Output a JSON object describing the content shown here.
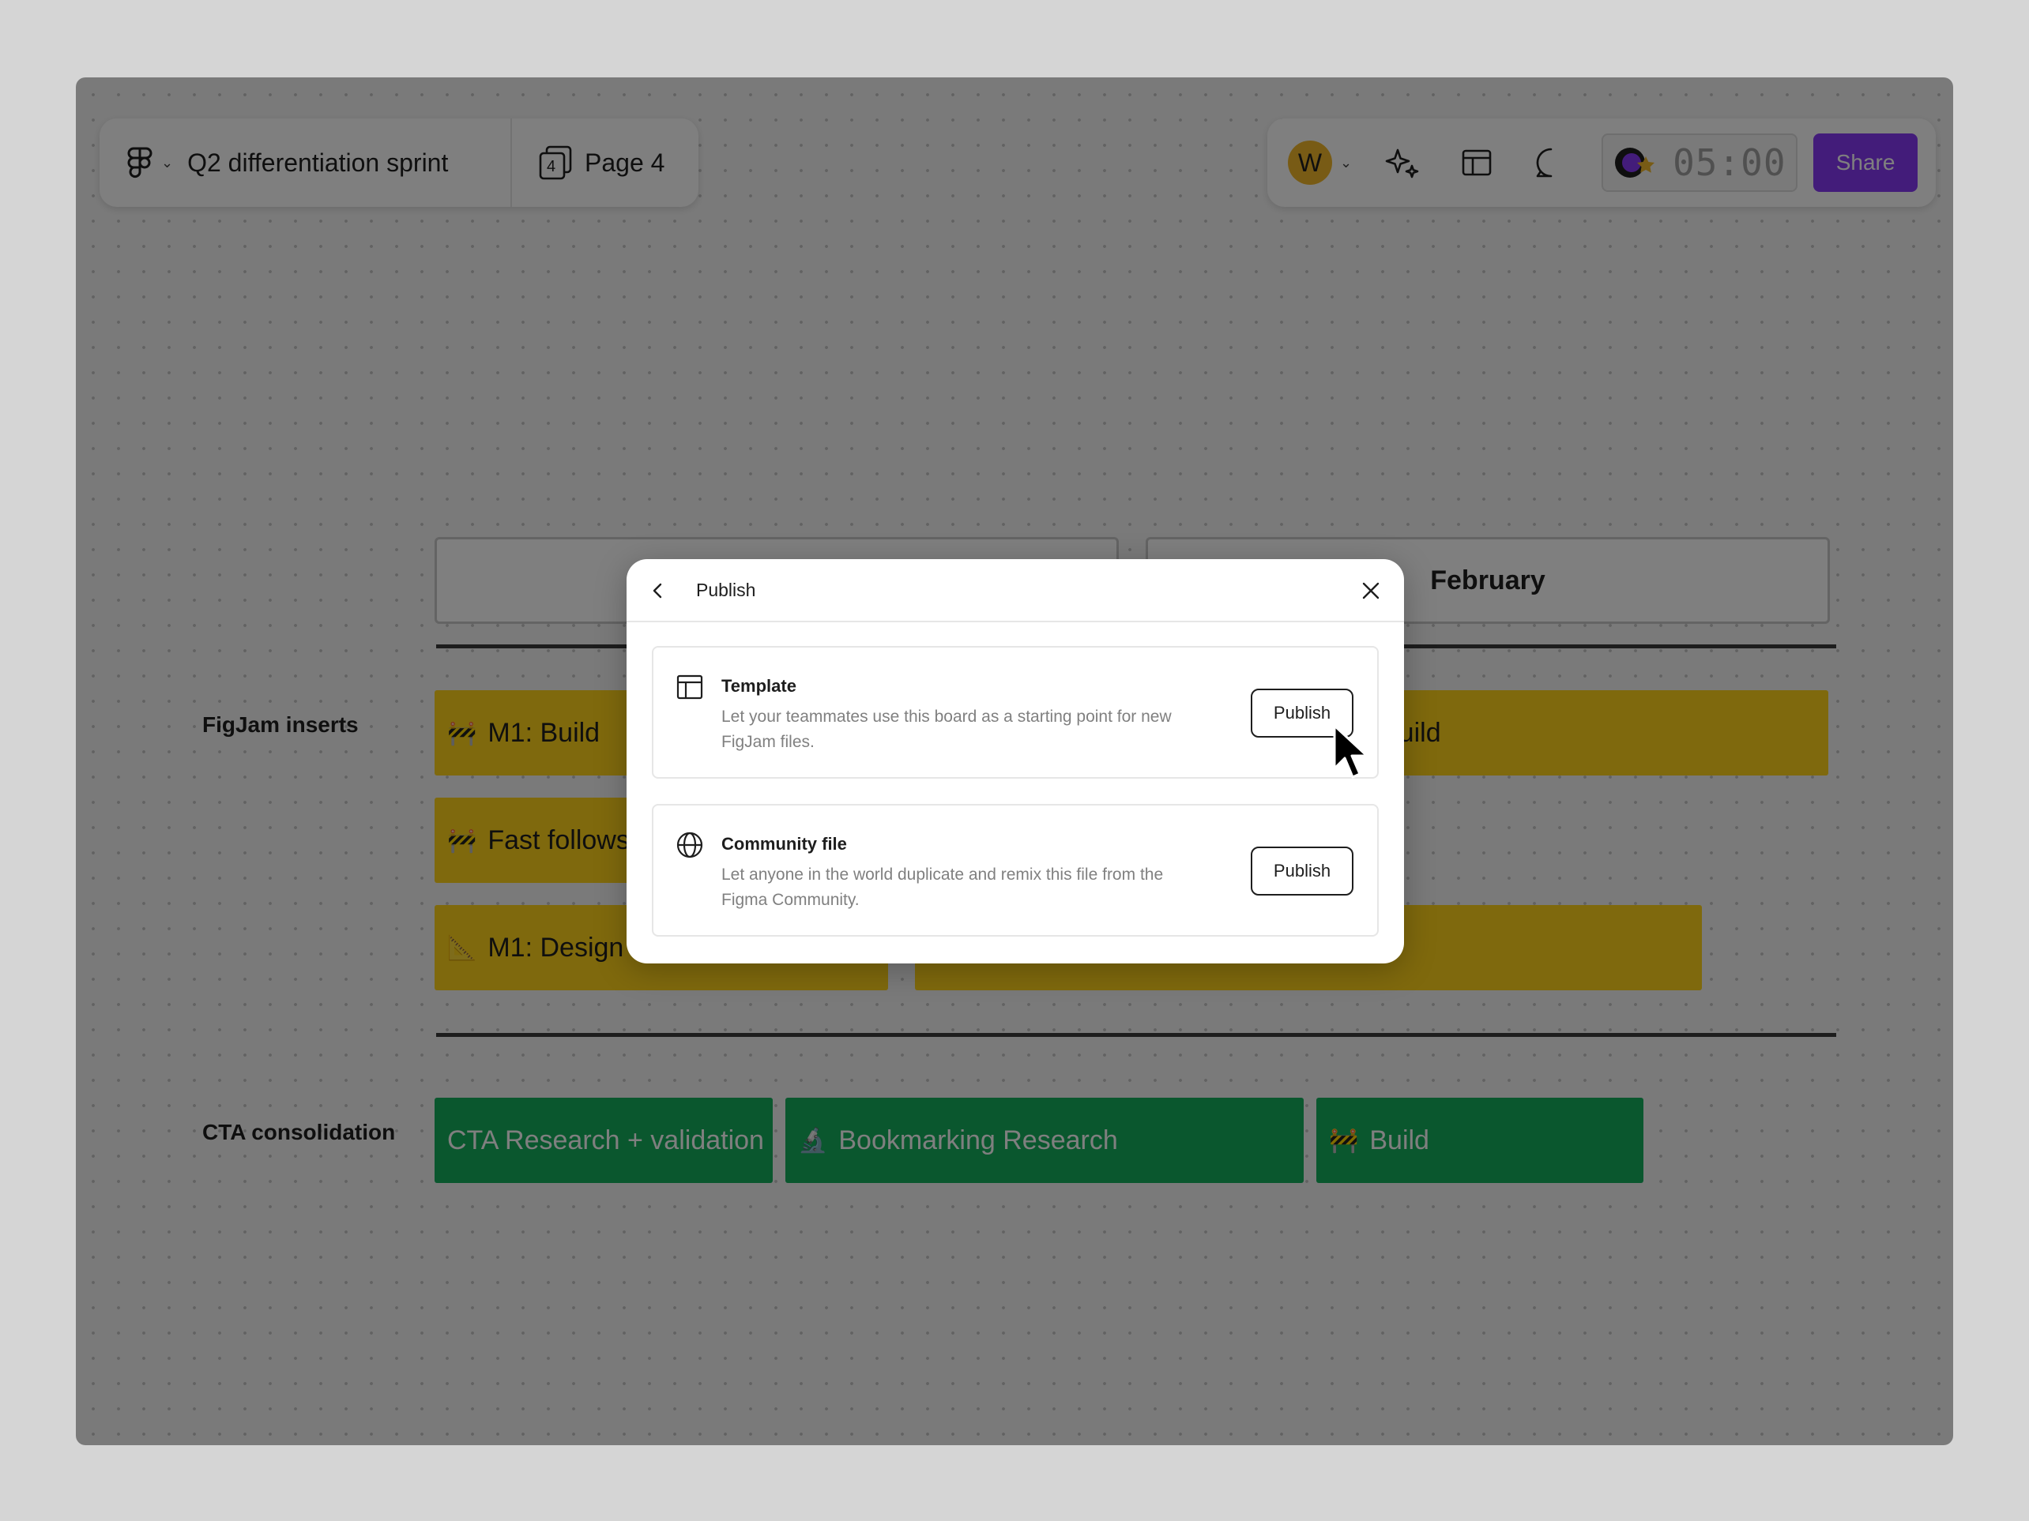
{
  "toolbar": {
    "file_title": "Q2 differentiation sprint",
    "page_count": "4",
    "page_name": "Page 4",
    "avatar_initial": "W",
    "timer": "05:00",
    "share_label": "Share"
  },
  "board": {
    "months": [
      "",
      "February"
    ],
    "rows": [
      {
        "label": "FigJam inserts"
      },
      {
        "label": "CTA consolidation"
      }
    ],
    "bars": {
      "m1_build": {
        "emoji": "🚧",
        "label": "M1: Build"
      },
      "right_build": {
        "label": "Build"
      },
      "fast_follows": {
        "emoji": "🚧",
        "label": "Fast follows"
      },
      "m1_design": {
        "emoji": "📐",
        "label": "M1: Design"
      },
      "cta_research": {
        "label": "CTA Research + validation"
      },
      "bookmarking": {
        "emoji": "🔬",
        "label": "Bookmarking Research"
      },
      "cta_build": {
        "emoji": "🚧",
        "label": "Build"
      }
    },
    "colors": {
      "yellow": "#ffd21a",
      "green": "#14ae5c"
    }
  },
  "dialog": {
    "title": "Publish",
    "options": [
      {
        "icon": "template-icon",
        "title": "Template",
        "description": "Let your teammates use this board as a starting point for new FigJam files.",
        "button": "Publish"
      },
      {
        "icon": "globe-icon",
        "title": "Community file",
        "description": "Let anyone in the world duplicate and remix this file from the Figma Community.",
        "button": "Publish"
      }
    ]
  },
  "colors": {
    "accent": "#8739f5",
    "avatar": "#f0b72a"
  }
}
